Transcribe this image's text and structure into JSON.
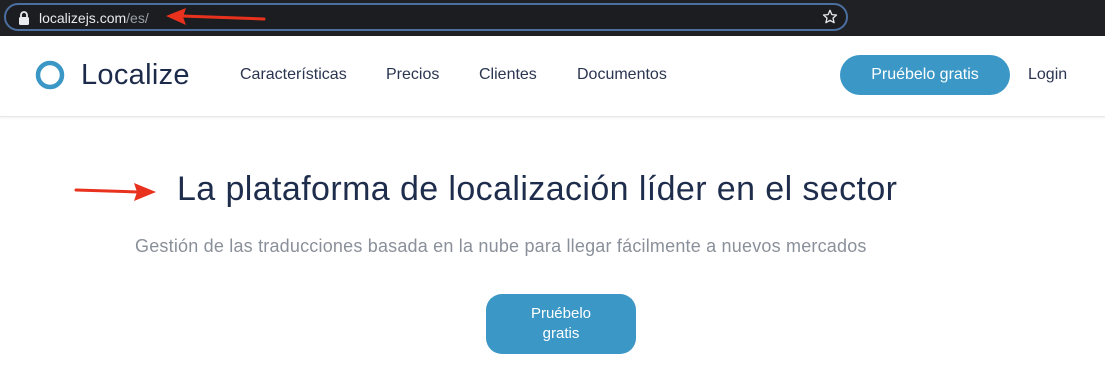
{
  "browser": {
    "url_domain": "localizejs.com",
    "url_path": "/es/",
    "icons": {
      "lock": "lock-icon",
      "bookmark": "star-icon"
    }
  },
  "nav": {
    "logo_text": "Localize",
    "links": [
      "Características",
      "Precios",
      "Clientes",
      "Documentos"
    ],
    "cta_label": "Pruébelo gratis",
    "login_label": "Login"
  },
  "hero": {
    "title": "La plataforma de localización líder en el sector",
    "subtitle": "Gestión de las traducciones basada en la nube para llegar fácilmente a nuevos mercados",
    "cta_label": "Pruébelo gratis"
  },
  "colors": {
    "brand_blue": "#3b97c5",
    "annotation_red": "#e8321e",
    "heading_navy": "#1f2d4c"
  }
}
